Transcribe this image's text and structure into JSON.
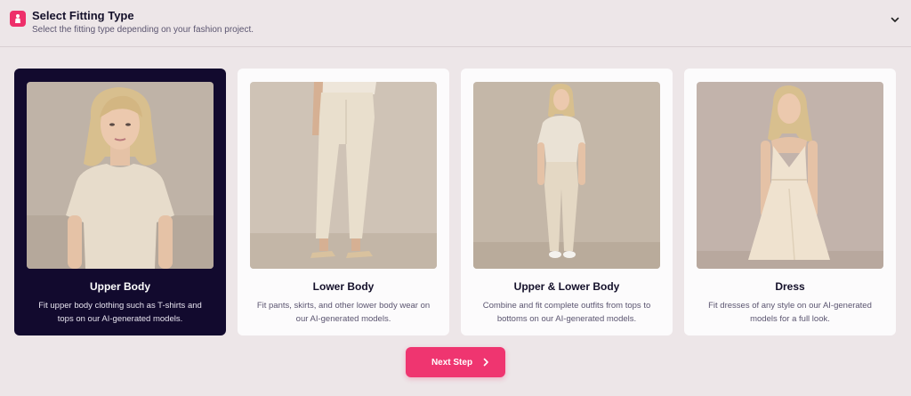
{
  "header": {
    "title": "Select Fitting Type",
    "subtitle": "Select the fitting type depending on your fashion project.",
    "icon": "model-icon",
    "collapse_icon": "chevron-down-icon"
  },
  "cards": [
    {
      "title": "Upper Body",
      "description": "Fit upper body clothing such as T-shirts and tops on our AI-generated models.",
      "selected": true,
      "image": "woman-tshirt-portrait"
    },
    {
      "title": "Lower Body",
      "description": "Fit pants, skirts, and other lower body wear on our AI-generated models.",
      "selected": false,
      "image": "woman-trousers-legs"
    },
    {
      "title": "Upper & Lower Body",
      "description": "Combine and fit complete outfits from tops to bottoms on our AI-generated models.",
      "selected": false,
      "image": "woman-full-outfit"
    },
    {
      "title": "Dress",
      "description": "Fit dresses of any style on our AI-generated models for a full look.",
      "selected": false,
      "image": "woman-dress"
    }
  ],
  "next_button": {
    "label": "Next Step",
    "icon": "chevron-right-icon"
  },
  "colors": {
    "accent": "#ef3570",
    "selected_card": "#120a2e",
    "background": "#ede6e8"
  }
}
